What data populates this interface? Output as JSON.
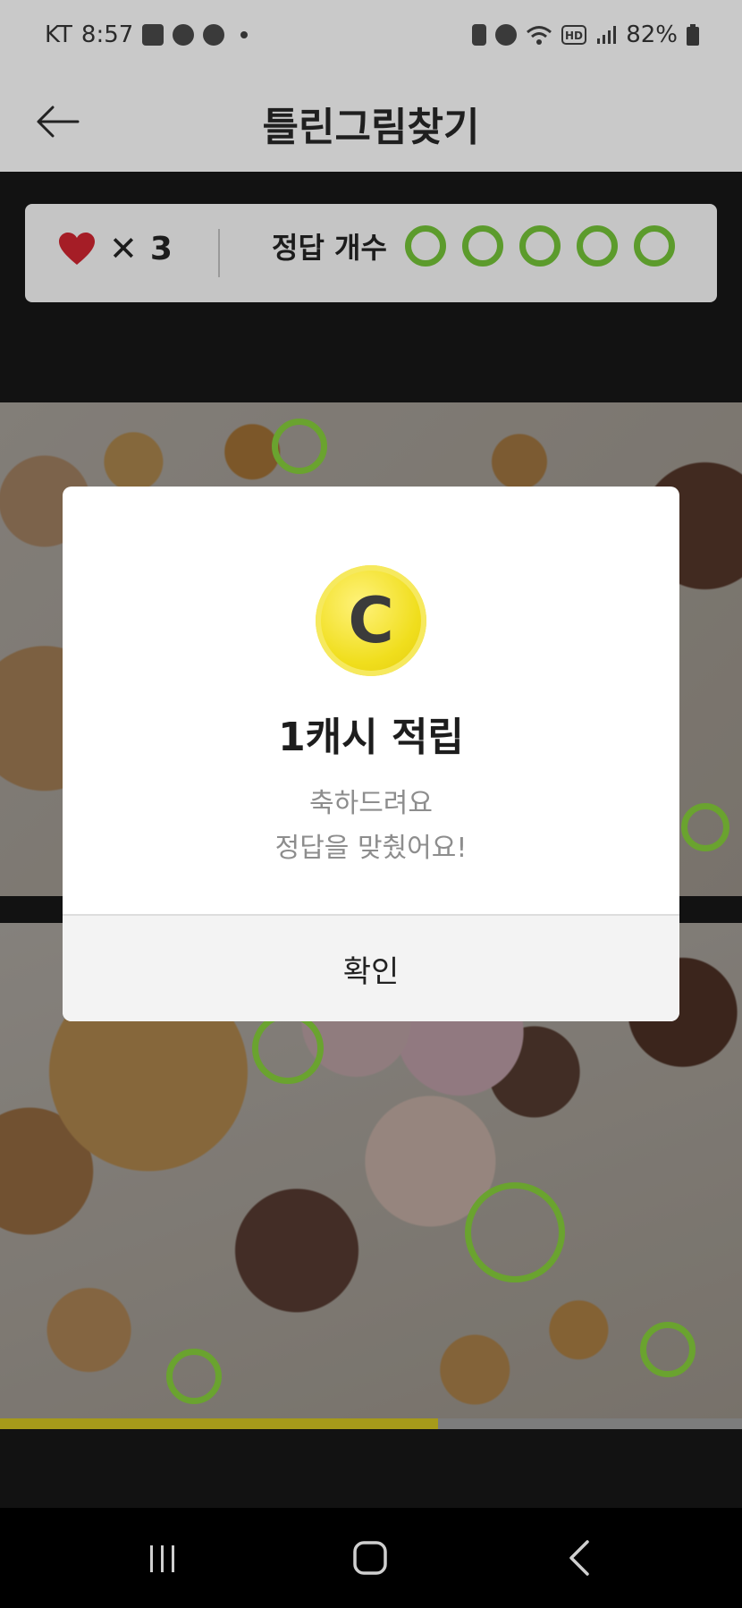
{
  "status_bar": {
    "carrier": "KT",
    "time": "8:57",
    "battery": "82%",
    "left_icons": [
      "gallery-icon",
      "app-icon",
      "app-icon"
    ],
    "right_icons": [
      "battery-saver-icon",
      "alarm-icon",
      "wifi-icon",
      "hd-icon",
      "signal-icon",
      "battery-icon"
    ]
  },
  "header": {
    "title": "틀린그림찾기",
    "back_icon": "back-arrow-icon"
  },
  "score": {
    "lives_symbol": "✕",
    "lives": "3",
    "answers_label": "정답 개수",
    "answer_slots": 5,
    "answer_slot_color": "#5c9b2c"
  },
  "progress": {
    "fraction": 0.59
  },
  "dialog": {
    "coin_letter": "C",
    "title": "1캐시 적립",
    "message_line1": "축하드려요",
    "message_line2": "정답을 맞췄어요!",
    "confirm_label": "확인"
  },
  "colors": {
    "heart": "#c8202b",
    "found_ring": "#6aa32f",
    "coin": "#f0de1d"
  }
}
